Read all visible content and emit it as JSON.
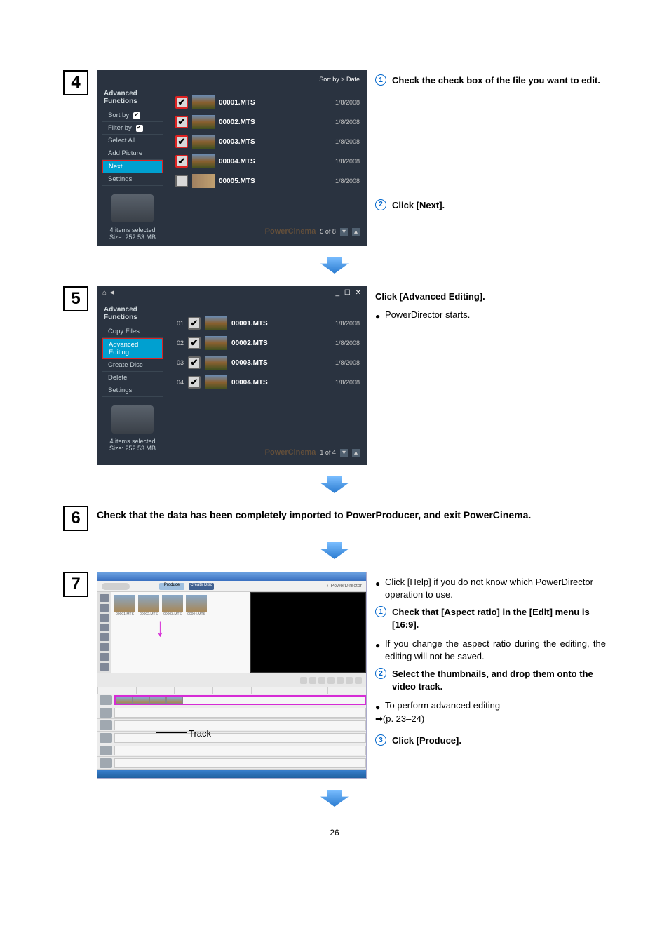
{
  "steps": {
    "s4": "4",
    "s5": "5",
    "s6": "6",
    "s7": "7"
  },
  "shot4": {
    "sortby_header": "Sort by > Date",
    "sidebar_title": "Advanced Functions",
    "menu": {
      "sortby": "Sort by",
      "filterby": "Filter by",
      "selectall": "Select All",
      "addpic": "Add Picture",
      "next": "Next",
      "settings": "Settings"
    },
    "status_l1": "4 items selected",
    "status_l2": "Size: 252.53 MB",
    "rows": [
      {
        "name": "00001.MTS",
        "date": "1/8/2008",
        "checked": "✔"
      },
      {
        "name": "00002.MTS",
        "date": "1/8/2008",
        "checked": "✔"
      },
      {
        "name": "00003.MTS",
        "date": "1/8/2008",
        "checked": "✔"
      },
      {
        "name": "00004.MTS",
        "date": "1/8/2008",
        "checked": "✔"
      },
      {
        "name": "00005.MTS",
        "date": "1/8/2008",
        "checked": ""
      }
    ],
    "watermark": "PowerCinema",
    "pager": "5 of 8"
  },
  "notes4": {
    "n1": "Check the check box of the file you want to edit.",
    "n2": "Click [Next]."
  },
  "shot5": {
    "winctl": "_ ☐ ✕",
    "sidebar_title": "Advanced Functions",
    "menu": {
      "copy": "Copy Files",
      "advedit": "Advanced Editing",
      "create": "Create Disc",
      "delete": "Delete",
      "settings": "Settings"
    },
    "status_l1": "4 items selected",
    "status_l2": "Size: 252.53 MB",
    "rows": [
      {
        "idx": "01",
        "name": "00001.MTS",
        "date": "1/8/2008"
      },
      {
        "idx": "02",
        "name": "00002.MTS",
        "date": "1/8/2008"
      },
      {
        "idx": "03",
        "name": "00003.MTS",
        "date": "1/8/2008"
      },
      {
        "idx": "04",
        "name": "00004.MTS",
        "date": "1/8/2008"
      }
    ],
    "watermark": "PowerCinema",
    "pager": "1 of 4"
  },
  "notes5": {
    "heading": "Click [Advanced Editing].",
    "b1": "PowerDirector starts."
  },
  "step6_text": "Check that the data has been completely imported to PowerProducer, and exit PowerCinema.",
  "shot7": {
    "tab_produce": "Produce",
    "tab_createdisc": "Create Disc",
    "logo": "PowerDirector",
    "liblabels": [
      "00001.MTS",
      "00002.MTS",
      "00003.MTS",
      "00004.MTS"
    ],
    "track_label": "Track"
  },
  "notes7": {
    "b1": "Click [Help] if you do not know which PowerDirector operation to use.",
    "n1": "Check that [Aspect ratio] in the [Edit] menu is [16:9].",
    "b2": "If you change the aspect ratio during the editing, the editing will not be saved.",
    "n2": "Select the thumbnails, and drop them onto the video track.",
    "b3": "To perform advanced editing",
    "ref": "➡(p. 23–24)",
    "n3": "Click [Produce]."
  },
  "circ": {
    "c1": "1",
    "c2": "2",
    "c3": "3"
  },
  "page_number": "26"
}
